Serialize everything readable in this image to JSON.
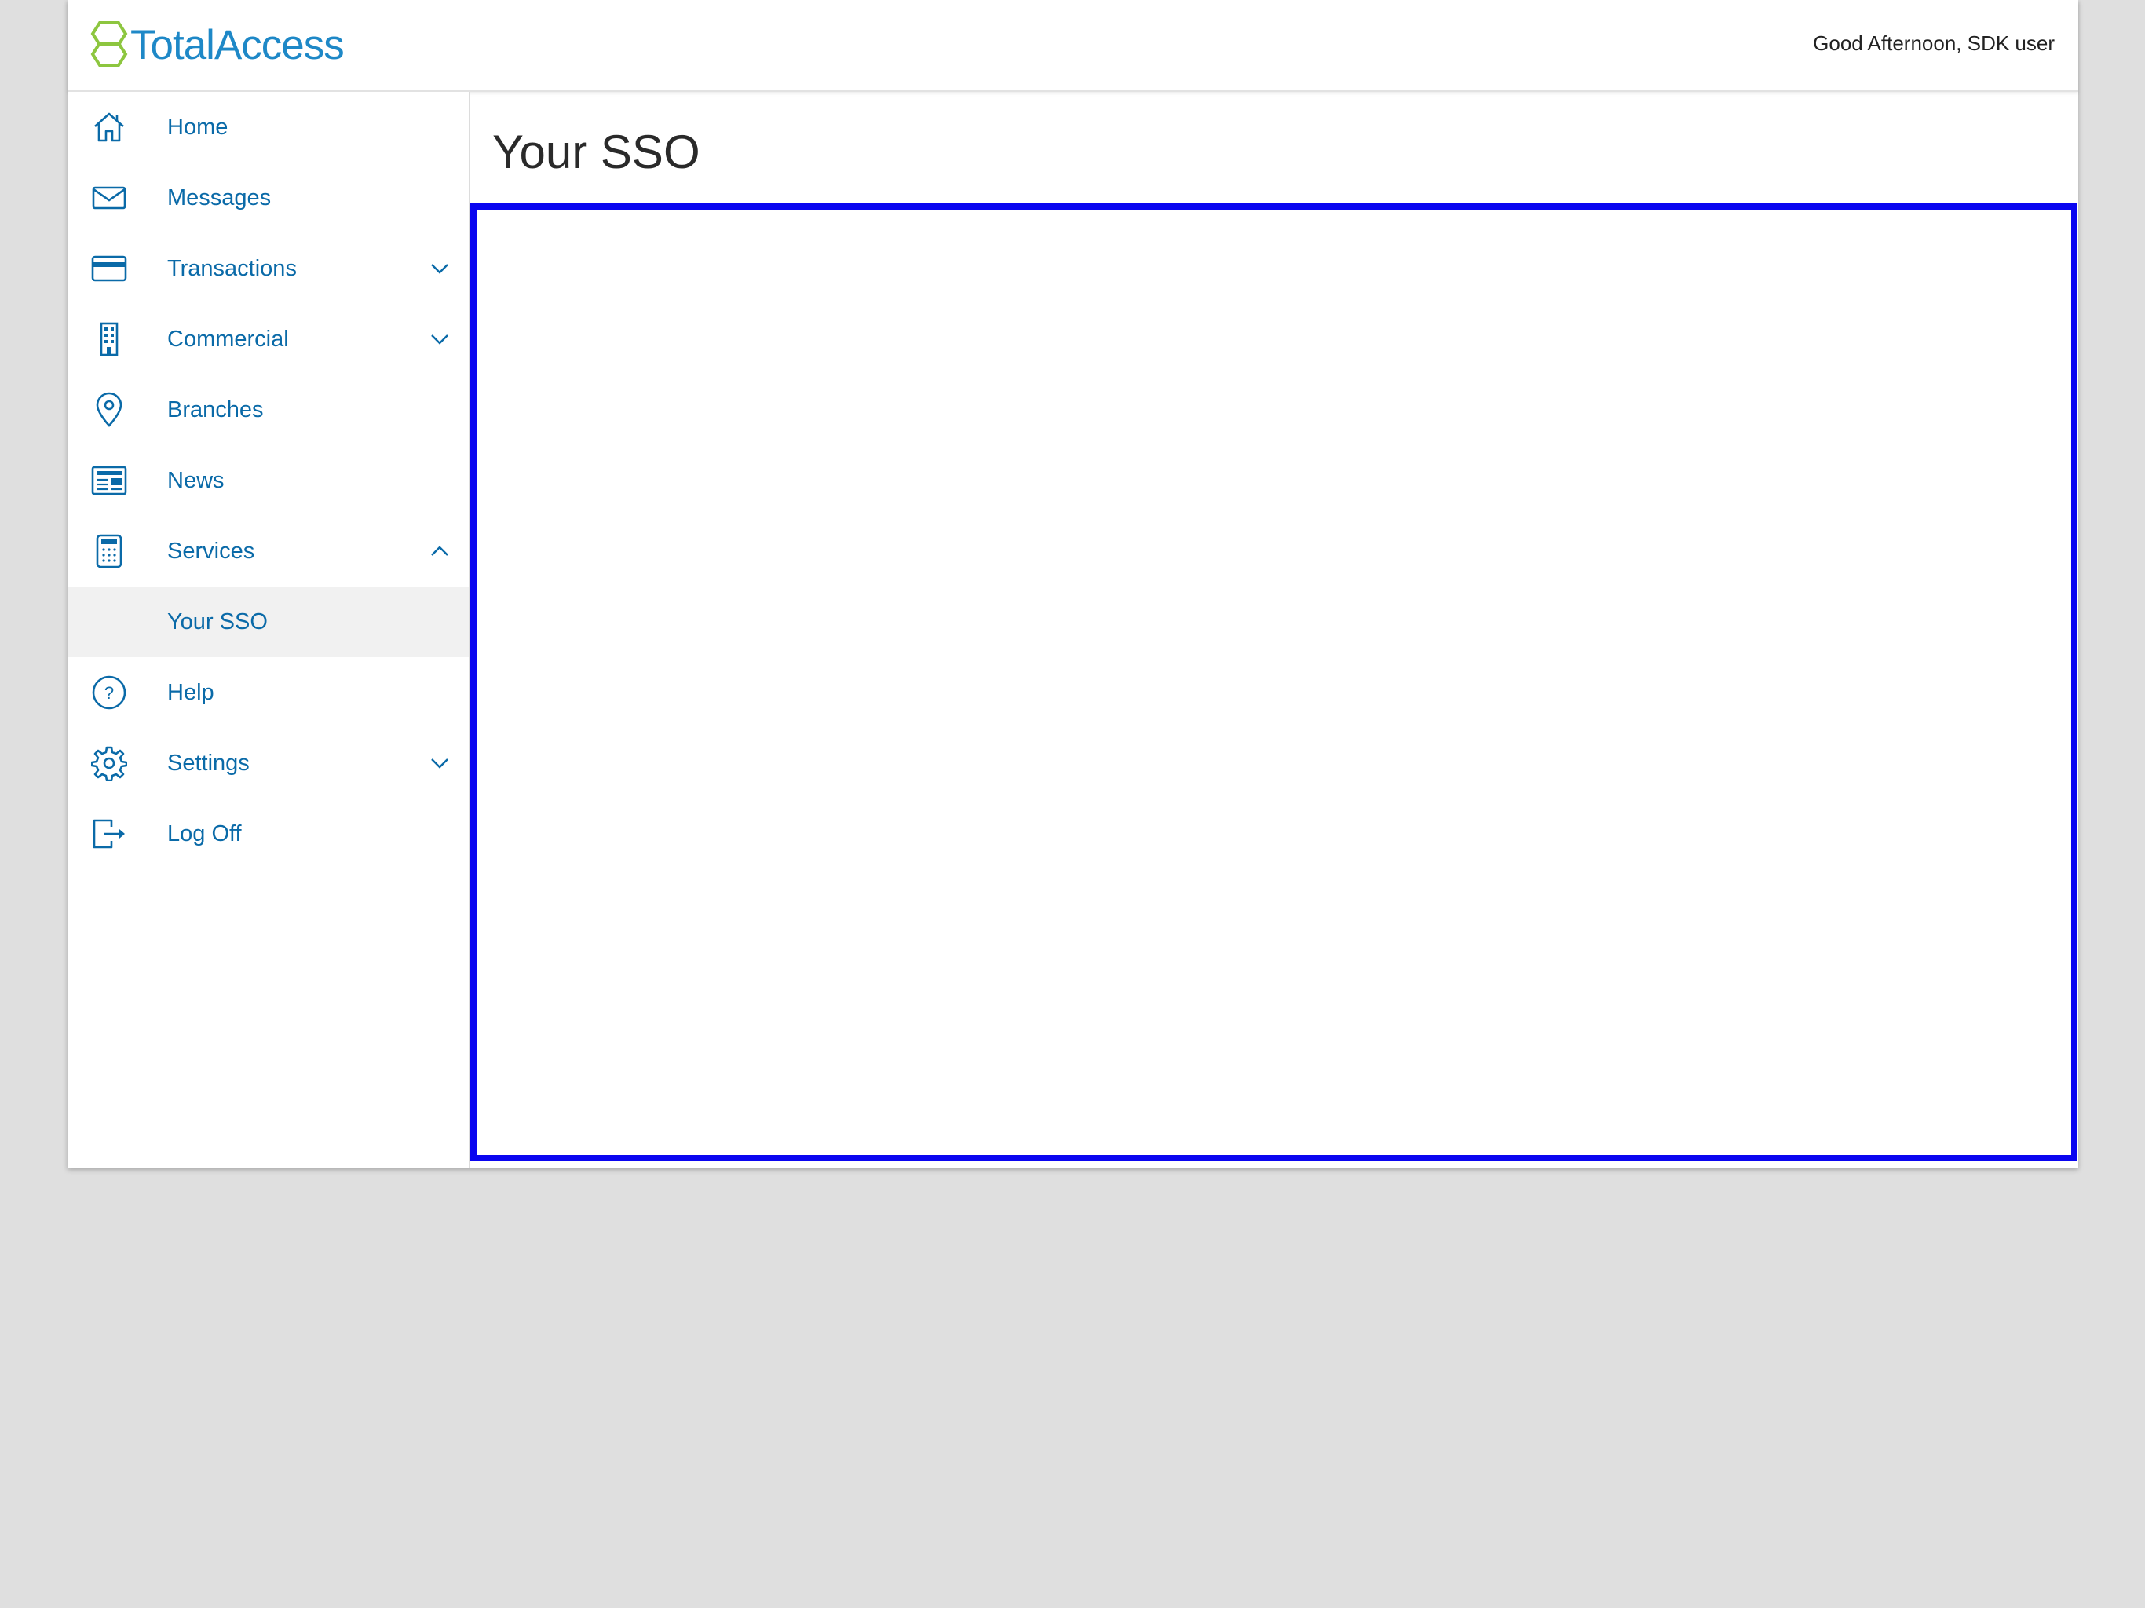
{
  "header": {
    "brand": "TotalAccess",
    "greeting": "Good Afternoon, SDK user"
  },
  "sidebar": {
    "items": [
      {
        "label": "Home",
        "icon": "home-icon"
      },
      {
        "label": "Messages",
        "icon": "envelope-icon"
      },
      {
        "label": "Transactions",
        "icon": "credit-card-icon",
        "expandable": true,
        "expanded": false
      },
      {
        "label": "Commercial",
        "icon": "building-icon",
        "expandable": true,
        "expanded": false
      },
      {
        "label": "Branches",
        "icon": "map-pin-icon"
      },
      {
        "label": "News",
        "icon": "newspaper-icon"
      },
      {
        "label": "Services",
        "icon": "calculator-icon",
        "expandable": true,
        "expanded": true
      },
      {
        "label": "Your SSO",
        "sub": true,
        "selected": true
      },
      {
        "label": "Help",
        "icon": "question-circle-icon"
      },
      {
        "label": "Settings",
        "icon": "gear-icon",
        "expandable": true,
        "expanded": false
      },
      {
        "label": "Log Off",
        "icon": "logout-icon"
      }
    ]
  },
  "main": {
    "title": "Your SSO"
  },
  "colors": {
    "brand_blue": "#1e88c7",
    "nav_blue": "#0a6aa8",
    "logo_green": "#8dc63f",
    "frame_border": "#0a05f0",
    "selected_bg": "#f1f1f1"
  }
}
